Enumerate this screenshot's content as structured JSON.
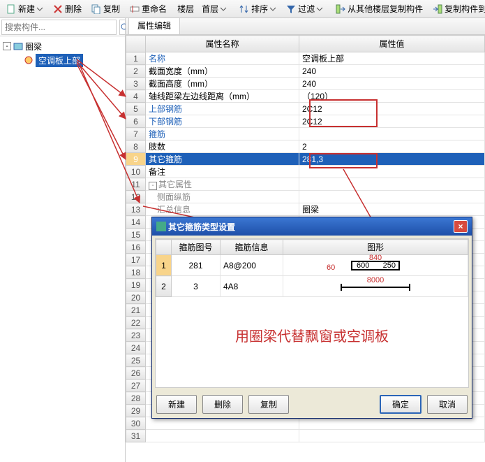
{
  "toolbar": {
    "new": "新建",
    "delete": "删除",
    "copy": "复制",
    "rename": "重命名",
    "floor_label": "楼层",
    "floor_value": "首层",
    "sort": "排序",
    "filter": "过滤",
    "copy_from": "从其他楼层复制构件",
    "copy_to": "复制构件到其他"
  },
  "search": {
    "placeholder": "搜索构件..."
  },
  "tree": {
    "root": "圈梁",
    "child": "空调板上部"
  },
  "tab": "属性编辑",
  "grid": {
    "col_name": "属性名称",
    "col_value": "属性值",
    "rows": [
      {
        "n": "1",
        "name": "名称",
        "value": "空调板上部",
        "link": true
      },
      {
        "n": "2",
        "name": "截面宽度（mm）",
        "value": "240"
      },
      {
        "n": "3",
        "name": "截面高度（mm）",
        "value": "240"
      },
      {
        "n": "4",
        "name": "轴线距梁左边线距离（mm）",
        "value": "（120）"
      },
      {
        "n": "5",
        "name": "上部钢筋",
        "value": "2C12",
        "link": true
      },
      {
        "n": "6",
        "name": "下部钢筋",
        "value": "2C12",
        "link": true
      },
      {
        "n": "7",
        "name": "箍筋",
        "value": "",
        "link": true
      },
      {
        "n": "8",
        "name": "肢数",
        "value": "2"
      },
      {
        "n": "9",
        "name": "其它箍筋",
        "value": "281,3",
        "sel": true
      },
      {
        "n": "10",
        "name": "备注",
        "value": ""
      },
      {
        "n": "11",
        "name": "其它属性",
        "value": "",
        "sub": true,
        "collapse": "-"
      },
      {
        "n": "12",
        "name": "　侧面纵筋",
        "value": "",
        "sub": true,
        "link": true
      },
      {
        "n": "13",
        "name": "　汇总信息",
        "value": "圈梁",
        "sub": true
      },
      {
        "n": "14",
        "name": "",
        "value": ""
      },
      {
        "n": "15",
        "name": "",
        "value": ""
      },
      {
        "n": "16",
        "name": "",
        "value": ""
      },
      {
        "n": "17",
        "name": "",
        "value": ""
      },
      {
        "n": "18",
        "name": "",
        "value": ""
      },
      {
        "n": "19",
        "name": "",
        "value": ""
      },
      {
        "n": "20",
        "name": "",
        "value": ""
      },
      {
        "n": "21",
        "name": "",
        "value": ""
      },
      {
        "n": "22",
        "name": "",
        "value": ""
      },
      {
        "n": "23",
        "name": "",
        "value": ""
      },
      {
        "n": "24",
        "name": "",
        "value": ""
      },
      {
        "n": "25",
        "name": "",
        "value": ""
      },
      {
        "n": "26",
        "name": "",
        "value": ""
      },
      {
        "n": "27",
        "name": "",
        "value": ""
      },
      {
        "n": "28",
        "name": "",
        "value": ""
      },
      {
        "n": "29",
        "name": "",
        "value": ""
      },
      {
        "n": "30",
        "name": "",
        "value": ""
      },
      {
        "n": "31",
        "name": "",
        "value": ""
      }
    ]
  },
  "dialog": {
    "title": "其它箍筋类型设置",
    "cols": {
      "num": "箍筋图号",
      "info": "箍筋信息",
      "shape": "图形"
    },
    "rows": [
      {
        "rn": "1",
        "num": "281",
        "info": "A8@200",
        "dims": {
          "top": "840",
          "a": "60",
          "b": "600",
          "c": "250"
        },
        "sel": true
      },
      {
        "rn": "2",
        "num": "3",
        "info": "4A8",
        "dims": {
          "len": "8000"
        }
      }
    ],
    "note": "用圈梁代替飘窗或空调板",
    "btns": {
      "new": "新建",
      "delete": "删除",
      "copy": "复制",
      "ok": "确定",
      "cancel": "取消"
    }
  }
}
